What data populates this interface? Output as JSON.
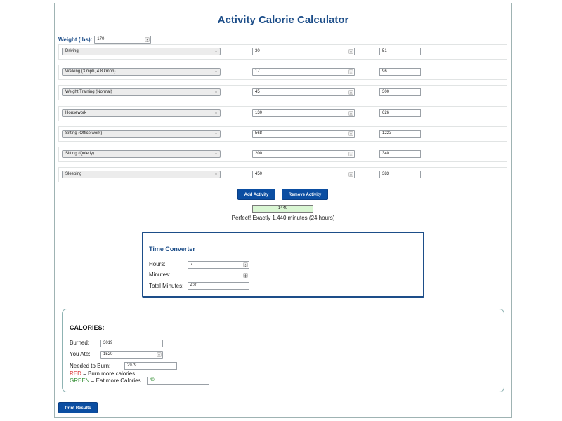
{
  "app": {
    "title": "Activity Calorie Calculator"
  },
  "weight": {
    "label": "Weight (lbs):",
    "value": "170"
  },
  "activities": [
    {
      "activity": "Driving",
      "minutes": "30",
      "calories": "51"
    },
    {
      "activity": "Walking (3 mph, 4.8 kmph)",
      "minutes": "17",
      "calories": "96"
    },
    {
      "activity": "Weight Training (Normal)",
      "minutes": "45",
      "calories": "300"
    },
    {
      "activity": "Housework",
      "minutes": "130",
      "calories": "626"
    },
    {
      "activity": "Sitting (Office work)",
      "minutes": "568",
      "calories": "1223"
    },
    {
      "activity": "Sitting (Quietly)",
      "minutes": "200",
      "calories": "340"
    },
    {
      "activity": "Sleeping",
      "minutes": "450",
      "calories": "383"
    }
  ],
  "buttons": {
    "add_activity": "Add Activity",
    "remove_activity": "Remove Activity",
    "print_results": "Print Results"
  },
  "total": {
    "minutes": "1440",
    "message": "Perfect! Exactly 1,440 minutes (24 hours)"
  },
  "converter": {
    "title": "Time Converter",
    "hours_label": "Hours:",
    "hours_value": "7",
    "minutes_label": "Minutes:",
    "minutes_value": "",
    "total_label": "Total Minutes:",
    "total_value": "420"
  },
  "calories": {
    "title": "CALORIES:",
    "burned_label": "Burned:",
    "burned_value": "3019",
    "ate_label": "You Ate:",
    "ate_value": "1520",
    "needed_label": "Needed to Burn:",
    "needed_value": "2979",
    "red_word": "RED",
    "red_text": " = Burn more calories",
    "green_word": "GREEN",
    "green_text": " = Eat more Calories",
    "green_value": "40"
  },
  "colors": {
    "accent": "#0b4ea2",
    "heading": "#1d4e89",
    "total_bg": "#d9f6d3",
    "red": "#d92c2c",
    "green": "#2e8b2e"
  },
  "icons": {
    "spinner": "spin-arrows-icon",
    "dropdown": "chevron-down-icon"
  }
}
